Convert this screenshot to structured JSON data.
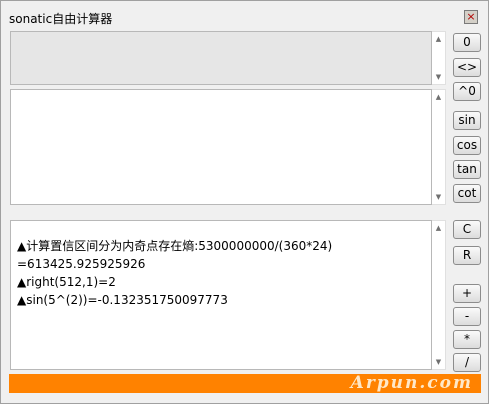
{
  "window": {
    "title": "sonatic自由计算器",
    "close_glyph": "×"
  },
  "buttons": {
    "zero": "0",
    "swap": "<>",
    "pow0": "^0",
    "sin": "sin",
    "cos": "cos",
    "tan": "tan",
    "cot": "cot",
    "clear": "C",
    "run": "R",
    "plus": "+",
    "minus": "-",
    "multiply": "*",
    "divide": "/"
  },
  "output": {
    "lines": [
      "▲计算置信区间分为内奇点存在熵:5300000000/(360*24)",
      "=613425.925925926",
      "▲right(512,1)=2",
      "▲sin(5^(2))=-0.132351750097773"
    ]
  },
  "statusbar": {
    "color": "#ff8200",
    "watermark": "Arpun.com"
  }
}
